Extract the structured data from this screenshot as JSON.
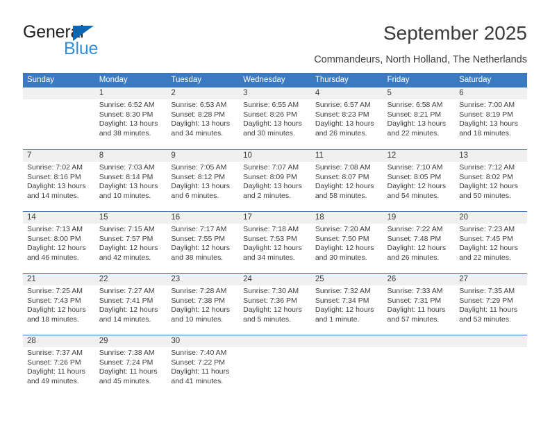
{
  "logo": {
    "word_dark": "General",
    "word_blue": "Blue",
    "triangle_color": "#0d66b0",
    "blue_color": "#2f8fd8"
  },
  "header": {
    "title": "September 2025",
    "subtitle": "Commandeurs, North Holland, The Netherlands"
  },
  "colors": {
    "header_blue": "#3b7ac0",
    "daynum_band": "#f0f0f0",
    "text": "#3c3c3c"
  },
  "weekdays": [
    "Sunday",
    "Monday",
    "Tuesday",
    "Wednesday",
    "Thursday",
    "Friday",
    "Saturday"
  ],
  "weeks": [
    [
      {
        "day": "",
        "sunrise": "",
        "sunset": "",
        "daylight1": "",
        "daylight2": ""
      },
      {
        "day": "1",
        "sunrise": "Sunrise: 6:52 AM",
        "sunset": "Sunset: 8:30 PM",
        "daylight1": "Daylight: 13 hours",
        "daylight2": "and 38 minutes."
      },
      {
        "day": "2",
        "sunrise": "Sunrise: 6:53 AM",
        "sunset": "Sunset: 8:28 PM",
        "daylight1": "Daylight: 13 hours",
        "daylight2": "and 34 minutes."
      },
      {
        "day": "3",
        "sunrise": "Sunrise: 6:55 AM",
        "sunset": "Sunset: 8:26 PM",
        "daylight1": "Daylight: 13 hours",
        "daylight2": "and 30 minutes."
      },
      {
        "day": "4",
        "sunrise": "Sunrise: 6:57 AM",
        "sunset": "Sunset: 8:23 PM",
        "daylight1": "Daylight: 13 hours",
        "daylight2": "and 26 minutes."
      },
      {
        "day": "5",
        "sunrise": "Sunrise: 6:58 AM",
        "sunset": "Sunset: 8:21 PM",
        "daylight1": "Daylight: 13 hours",
        "daylight2": "and 22 minutes."
      },
      {
        "day": "6",
        "sunrise": "Sunrise: 7:00 AM",
        "sunset": "Sunset: 8:19 PM",
        "daylight1": "Daylight: 13 hours",
        "daylight2": "and 18 minutes."
      }
    ],
    [
      {
        "day": "7",
        "sunrise": "Sunrise: 7:02 AM",
        "sunset": "Sunset: 8:16 PM",
        "daylight1": "Daylight: 13 hours",
        "daylight2": "and 14 minutes."
      },
      {
        "day": "8",
        "sunrise": "Sunrise: 7:03 AM",
        "sunset": "Sunset: 8:14 PM",
        "daylight1": "Daylight: 13 hours",
        "daylight2": "and 10 minutes."
      },
      {
        "day": "9",
        "sunrise": "Sunrise: 7:05 AM",
        "sunset": "Sunset: 8:12 PM",
        "daylight1": "Daylight: 13 hours",
        "daylight2": "and 6 minutes."
      },
      {
        "day": "10",
        "sunrise": "Sunrise: 7:07 AM",
        "sunset": "Sunset: 8:09 PM",
        "daylight1": "Daylight: 13 hours",
        "daylight2": "and 2 minutes."
      },
      {
        "day": "11",
        "sunrise": "Sunrise: 7:08 AM",
        "sunset": "Sunset: 8:07 PM",
        "daylight1": "Daylight: 12 hours",
        "daylight2": "and 58 minutes."
      },
      {
        "day": "12",
        "sunrise": "Sunrise: 7:10 AM",
        "sunset": "Sunset: 8:05 PM",
        "daylight1": "Daylight: 12 hours",
        "daylight2": "and 54 minutes."
      },
      {
        "day": "13",
        "sunrise": "Sunrise: 7:12 AM",
        "sunset": "Sunset: 8:02 PM",
        "daylight1": "Daylight: 12 hours",
        "daylight2": "and 50 minutes."
      }
    ],
    [
      {
        "day": "14",
        "sunrise": "Sunrise: 7:13 AM",
        "sunset": "Sunset: 8:00 PM",
        "daylight1": "Daylight: 12 hours",
        "daylight2": "and 46 minutes."
      },
      {
        "day": "15",
        "sunrise": "Sunrise: 7:15 AM",
        "sunset": "Sunset: 7:57 PM",
        "daylight1": "Daylight: 12 hours",
        "daylight2": "and 42 minutes."
      },
      {
        "day": "16",
        "sunrise": "Sunrise: 7:17 AM",
        "sunset": "Sunset: 7:55 PM",
        "daylight1": "Daylight: 12 hours",
        "daylight2": "and 38 minutes."
      },
      {
        "day": "17",
        "sunrise": "Sunrise: 7:18 AM",
        "sunset": "Sunset: 7:53 PM",
        "daylight1": "Daylight: 12 hours",
        "daylight2": "and 34 minutes."
      },
      {
        "day": "18",
        "sunrise": "Sunrise: 7:20 AM",
        "sunset": "Sunset: 7:50 PM",
        "daylight1": "Daylight: 12 hours",
        "daylight2": "and 30 minutes."
      },
      {
        "day": "19",
        "sunrise": "Sunrise: 7:22 AM",
        "sunset": "Sunset: 7:48 PM",
        "daylight1": "Daylight: 12 hours",
        "daylight2": "and 26 minutes."
      },
      {
        "day": "20",
        "sunrise": "Sunrise: 7:23 AM",
        "sunset": "Sunset: 7:45 PM",
        "daylight1": "Daylight: 12 hours",
        "daylight2": "and 22 minutes."
      }
    ],
    [
      {
        "day": "21",
        "sunrise": "Sunrise: 7:25 AM",
        "sunset": "Sunset: 7:43 PM",
        "daylight1": "Daylight: 12 hours",
        "daylight2": "and 18 minutes."
      },
      {
        "day": "22",
        "sunrise": "Sunrise: 7:27 AM",
        "sunset": "Sunset: 7:41 PM",
        "daylight1": "Daylight: 12 hours",
        "daylight2": "and 14 minutes."
      },
      {
        "day": "23",
        "sunrise": "Sunrise: 7:28 AM",
        "sunset": "Sunset: 7:38 PM",
        "daylight1": "Daylight: 12 hours",
        "daylight2": "and 10 minutes."
      },
      {
        "day": "24",
        "sunrise": "Sunrise: 7:30 AM",
        "sunset": "Sunset: 7:36 PM",
        "daylight1": "Daylight: 12 hours",
        "daylight2": "and 5 minutes."
      },
      {
        "day": "25",
        "sunrise": "Sunrise: 7:32 AM",
        "sunset": "Sunset: 7:34 PM",
        "daylight1": "Daylight: 12 hours",
        "daylight2": "and 1 minute."
      },
      {
        "day": "26",
        "sunrise": "Sunrise: 7:33 AM",
        "sunset": "Sunset: 7:31 PM",
        "daylight1": "Daylight: 11 hours",
        "daylight2": "and 57 minutes."
      },
      {
        "day": "27",
        "sunrise": "Sunrise: 7:35 AM",
        "sunset": "Sunset: 7:29 PM",
        "daylight1": "Daylight: 11 hours",
        "daylight2": "and 53 minutes."
      }
    ],
    [
      {
        "day": "28",
        "sunrise": "Sunrise: 7:37 AM",
        "sunset": "Sunset: 7:26 PM",
        "daylight1": "Daylight: 11 hours",
        "daylight2": "and 49 minutes."
      },
      {
        "day": "29",
        "sunrise": "Sunrise: 7:38 AM",
        "sunset": "Sunset: 7:24 PM",
        "daylight1": "Daylight: 11 hours",
        "daylight2": "and 45 minutes."
      },
      {
        "day": "30",
        "sunrise": "Sunrise: 7:40 AM",
        "sunset": "Sunset: 7:22 PM",
        "daylight1": "Daylight: 11 hours",
        "daylight2": "and 41 minutes."
      },
      {
        "day": "",
        "sunrise": "",
        "sunset": "",
        "daylight1": "",
        "daylight2": ""
      },
      {
        "day": "",
        "sunrise": "",
        "sunset": "",
        "daylight1": "",
        "daylight2": ""
      },
      {
        "day": "",
        "sunrise": "",
        "sunset": "",
        "daylight1": "",
        "daylight2": ""
      },
      {
        "day": "",
        "sunrise": "",
        "sunset": "",
        "daylight1": "",
        "daylight2": ""
      }
    ]
  ]
}
